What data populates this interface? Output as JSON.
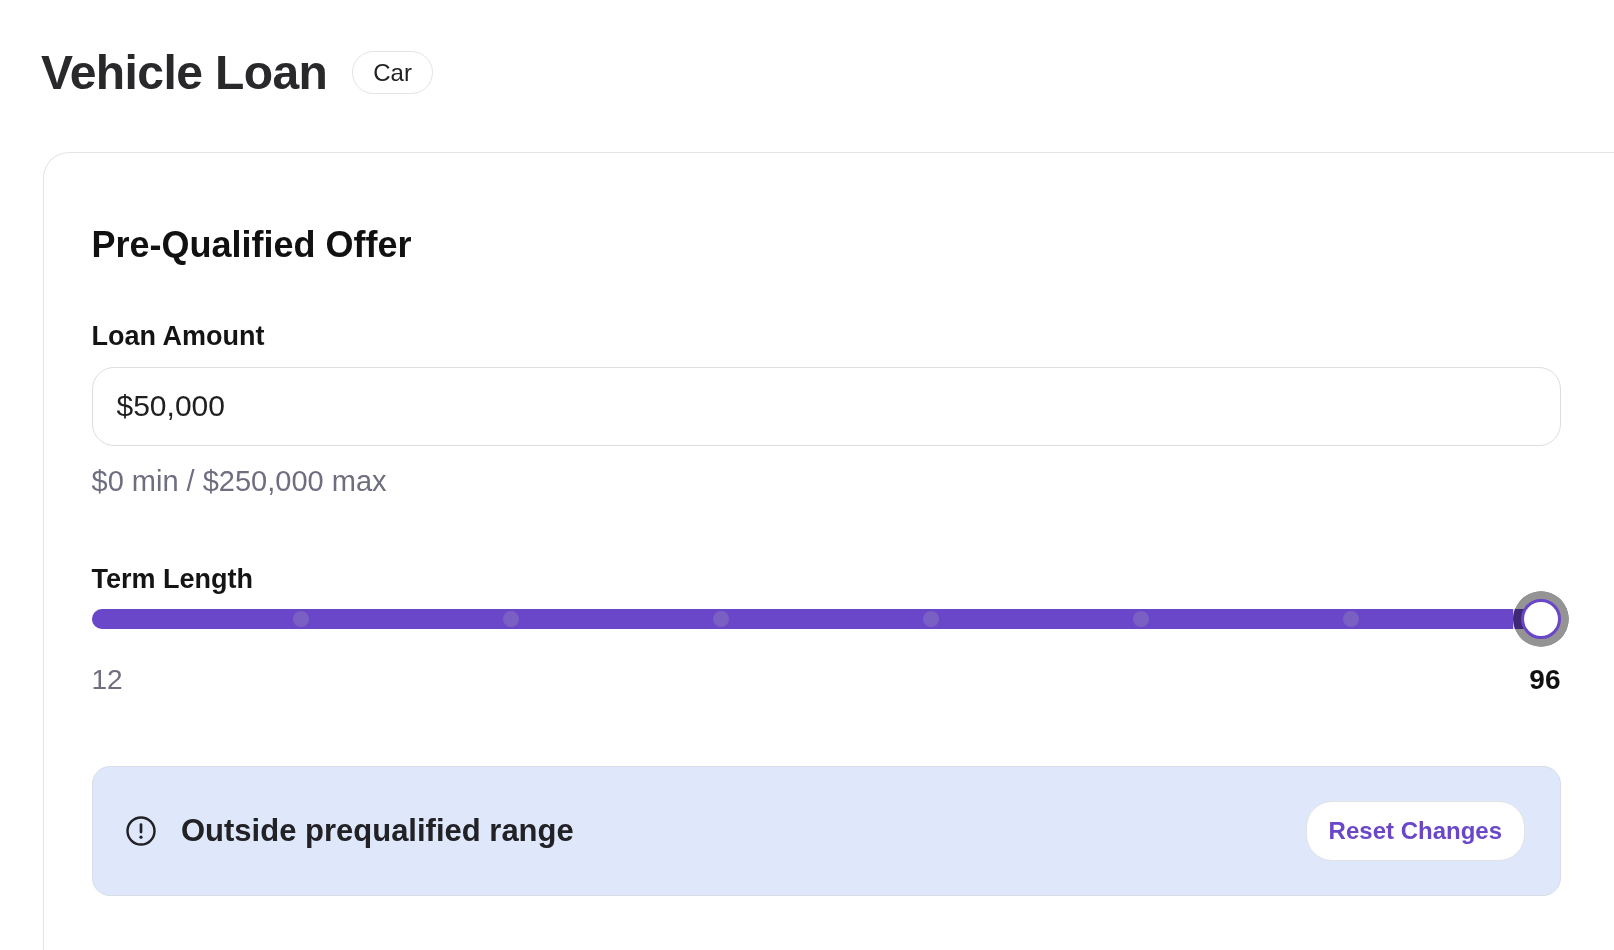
{
  "page": {
    "title": "Vehicle Loan",
    "badge": "Car"
  },
  "offer": {
    "title": "Pre-Qualified Offer",
    "loan_amount": {
      "label": "Loan Amount",
      "value": "$50,000",
      "hint": "$0 min / $250,000 max"
    },
    "term_length": {
      "label": "Term Length",
      "level": 1,
      "focused": true,
      "min_label": "12",
      "value_label": "96"
    },
    "alert": {
      "message": "Outside prequalified range",
      "action": "Reset Changes"
    }
  }
}
